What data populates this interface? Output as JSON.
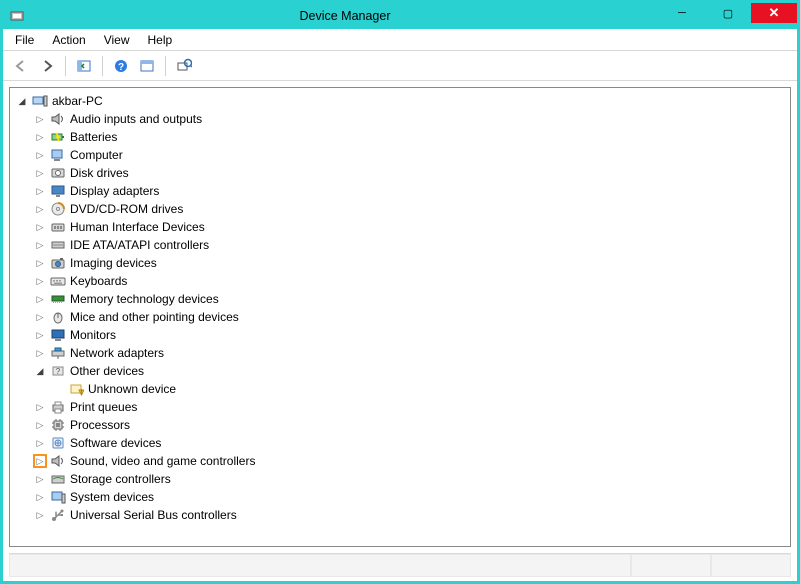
{
  "window": {
    "title": "Device Manager"
  },
  "menus": [
    "File",
    "Action",
    "View",
    "Help"
  ],
  "tree": {
    "root": {
      "label": "akbar-PC",
      "expanded": true,
      "icon": "computer-root",
      "children": [
        {
          "label": "Audio inputs and outputs",
          "icon": "speaker",
          "expanded": false
        },
        {
          "label": "Batteries",
          "icon": "battery",
          "expanded": false
        },
        {
          "label": "Computer",
          "icon": "computer",
          "expanded": false
        },
        {
          "label": "Disk drives",
          "icon": "disk",
          "expanded": false
        },
        {
          "label": "Display adapters",
          "icon": "display",
          "expanded": false
        },
        {
          "label": "DVD/CD-ROM drives",
          "icon": "cdrom",
          "expanded": false
        },
        {
          "label": "Human Interface Devices",
          "icon": "hid",
          "expanded": false
        },
        {
          "label": "IDE ATA/ATAPI controllers",
          "icon": "ide",
          "expanded": false
        },
        {
          "label": "Imaging devices",
          "icon": "camera",
          "expanded": false
        },
        {
          "label": "Keyboards",
          "icon": "keyboard",
          "expanded": false
        },
        {
          "label": "Memory technology devices",
          "icon": "memory",
          "expanded": false
        },
        {
          "label": "Mice and other pointing devices",
          "icon": "mouse",
          "expanded": false
        },
        {
          "label": "Monitors",
          "icon": "monitor",
          "expanded": false
        },
        {
          "label": "Network adapters",
          "icon": "network",
          "expanded": false
        },
        {
          "label": "Other devices",
          "icon": "other",
          "expanded": true,
          "children": [
            {
              "label": "Unknown device",
              "icon": "unknown",
              "leaf": true
            }
          ]
        },
        {
          "label": "Print queues",
          "icon": "printer",
          "expanded": false
        },
        {
          "label": "Processors",
          "icon": "cpu",
          "expanded": false
        },
        {
          "label": "Software devices",
          "icon": "software",
          "expanded": false
        },
        {
          "label": "Sound, video and game controllers",
          "icon": "speaker",
          "expanded": false,
          "highlight": true
        },
        {
          "label": "Storage controllers",
          "icon": "storage",
          "expanded": false
        },
        {
          "label": "System devices",
          "icon": "system",
          "expanded": false
        },
        {
          "label": "Universal Serial Bus controllers",
          "icon": "usb",
          "expanded": false
        }
      ]
    }
  }
}
